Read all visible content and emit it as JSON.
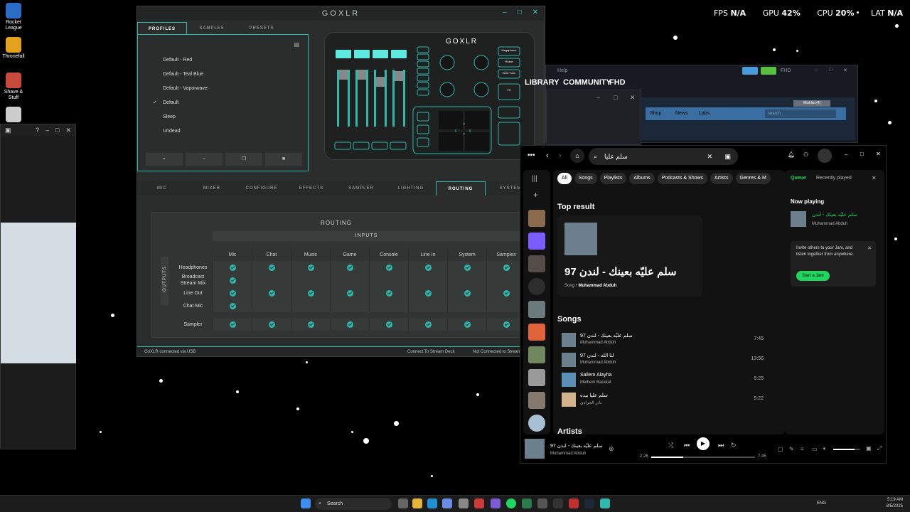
{
  "desktop": {
    "icons": [
      {
        "label": "Rocket League"
      },
      {
        "label": "Thronefall"
      },
      {
        "label": "Shave & Stuff"
      }
    ]
  },
  "overlay": {
    "fps_label": "FPS",
    "fps": "N/A",
    "gpu_label": "GPU",
    "gpu": "42",
    "cpu_label": "CPU",
    "cpu": "20",
    "lat_label": "LAT",
    "lat": "N/A",
    "percent": "%"
  },
  "goxlr": {
    "title": "GOXLR",
    "tabs_top": [
      "PROFILES",
      "SAMPLES",
      "PRESETS"
    ],
    "profiles": [
      "Default - Red",
      "Default - Teal Blue",
      "Default - Vaporwave",
      "Default",
      "Sleep",
      "Undead"
    ],
    "selected_profile_check": "✓",
    "device": {
      "logo": "GOXLR",
      "btn_top1": "Megaphone",
      "btn_top2": "Robot",
      "btn_top3": "Hard Tune",
      "btn_top4": "FX"
    },
    "tabs_main": [
      "MIC",
      "MIXER",
      "CONFIGURE",
      "EFFECTS",
      "SAMPLER",
      "LIGHTING",
      "ROUTING",
      "SYSTEM"
    ],
    "routing": {
      "title": "ROUTING",
      "inputs_label": "INPUTS",
      "outputs_label": "OUTPUTS",
      "columns": [
        "Mic",
        "Chat",
        "Music",
        "Game",
        "Console",
        "Line In",
        "System",
        "Samples"
      ],
      "rows": [
        {
          "label": "Headphones",
          "cells": [
            1,
            1,
            1,
            1,
            1,
            1,
            1,
            1
          ]
        },
        {
          "label": "Broadcast Stream Mix",
          "cells": [
            1,
            0,
            0,
            0,
            0,
            0,
            0,
            0
          ]
        },
        {
          "label": "Line Out",
          "cells": [
            1,
            1,
            1,
            1,
            1,
            1,
            1,
            1
          ]
        },
        {
          "label": "Chat Mic",
          "cells": [
            1,
            0,
            0,
            0,
            0,
            0,
            0,
            0
          ]
        }
      ],
      "sampler_row": {
        "label": "Sampler",
        "cells": [
          1,
          1,
          1,
          1,
          1,
          1,
          1,
          1
        ]
      }
    },
    "status": {
      "connection": "GoXLR connected via USB",
      "stream_deck": "Connect To Stream Deck",
      "stream": "Not Connected to Stream"
    }
  },
  "steam": {
    "menu_help": "Help",
    "nav": [
      "LIBRARY",
      "COMMUNITY",
      "FHD"
    ],
    "store_links": [
      "Shop",
      "News",
      "Labs"
    ],
    "wishlist": "Wishlist (4)",
    "search_placeholder": "search",
    "res": "FHD"
  },
  "spotify": {
    "search_value": "سلم عليا",
    "chips": [
      "All",
      "Songs",
      "Playlists",
      "Albums",
      "Podcasts & Shows",
      "Artists",
      "Genres & M"
    ],
    "top_result_heading": "Top result",
    "top_result": {
      "title": "سلم عليّه بعينك - لندن 97",
      "type": "Song",
      "artist": "Muhammad Abduh"
    },
    "songs_heading": "Songs",
    "songs": [
      {
        "title": "سلم عليّه بعينك - لندن 97",
        "artist": "Muhammad Abduh",
        "duration": "7:45"
      },
      {
        "title": "لنا الله - لندن 97",
        "artist": "Muhammad Abduh",
        "duration": "13:56"
      },
      {
        "title": "Sallem Alayha",
        "artist": "Melhem Barakat",
        "duration": "5:25"
      },
      {
        "title": "سلم عليا بيده",
        "artist": "نادر الجرادي",
        "duration": "5:22"
      }
    ],
    "artists_heading": "Artists",
    "queue": {
      "tab_queue": "Queue",
      "tab_recent": "Recently played",
      "now_playing": "Now playing",
      "np_title": "سلم عليّه بعينك - لندن",
      "np_artist": "Muhammad Abduh",
      "jam_text": "Invite others to your Jam, and listen together from anywhere.",
      "jam_button": "Start a Jam"
    },
    "player": {
      "title": "سلم عليّه بعينك - لندن 97",
      "artist": "Muhammad Abduh",
      "elapsed": "2:26",
      "total": "7:45",
      "progress": 0.31,
      "volume": 0.8
    },
    "accent": "#1ed760"
  },
  "taskbar": {
    "search_label": "Search",
    "lang": "ENG",
    "time": "5:19 AM",
    "date": "8/5/2025"
  }
}
